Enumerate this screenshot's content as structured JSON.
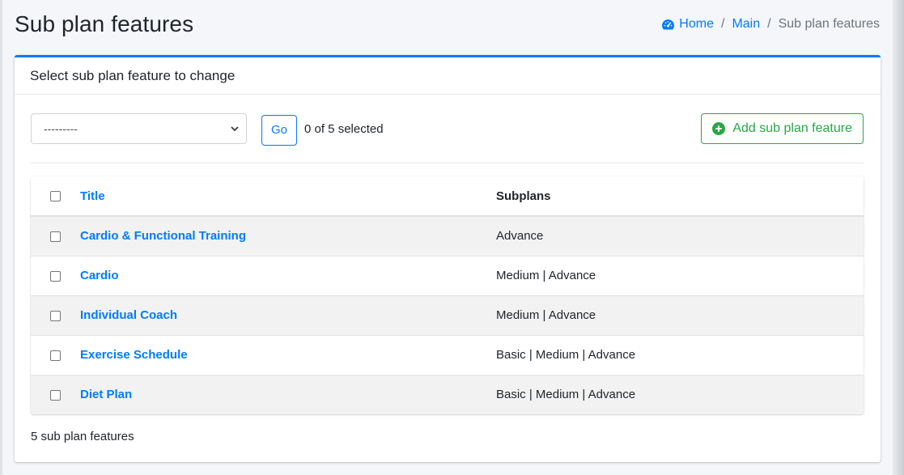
{
  "header": {
    "title": "Sub plan features",
    "breadcrumb": [
      {
        "label": "Home",
        "icon": "dashboard-icon"
      },
      {
        "label": "Main"
      },
      {
        "label": "Sub plan features"
      }
    ],
    "separator": "/"
  },
  "card": {
    "title": "Select sub plan feature to change"
  },
  "actions": {
    "select_value": "---------",
    "go_label": "Go",
    "selected_text": "0 of 5 selected",
    "add_label": "Add sub plan feature"
  },
  "table": {
    "columns": [
      "Title",
      "Subplans"
    ],
    "rows": [
      {
        "title": "Cardio & Functional Training",
        "subplans": "Advance"
      },
      {
        "title": "Cardio",
        "subplans": "Medium | Advance"
      },
      {
        "title": "Individual Coach",
        "subplans": "Medium | Advance"
      },
      {
        "title": "Exercise Schedule",
        "subplans": "Basic | Medium | Advance"
      },
      {
        "title": "Diet Plan",
        "subplans": "Basic | Medium | Advance"
      }
    ]
  },
  "footer": {
    "count_text": "5 sub plan features"
  },
  "colors": {
    "accent": "#007bff",
    "success": "#28a745",
    "stripe": "#f2f2f2"
  }
}
